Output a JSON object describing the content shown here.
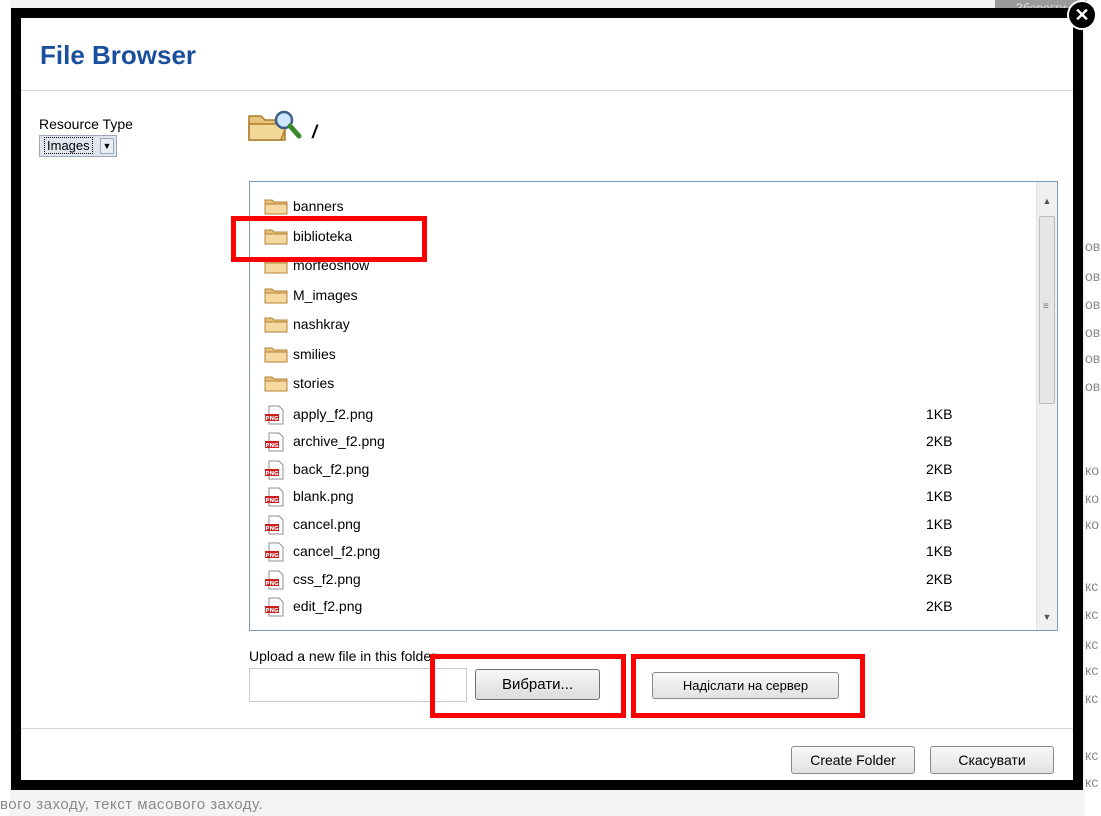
{
  "dialog": {
    "title": "File Browser",
    "resource_type_label": "Resource Type",
    "resource_type_value": "Images",
    "path": "/",
    "upload_label": "Upload a new file in this folder",
    "browse_button": "Вибрати...",
    "send_button": "Надіслати на сервер",
    "create_folder_button": "Create Folder",
    "cancel_button": "Скасувати",
    "close_icon": "close-icon",
    "path_icon": "folder-search-icon"
  },
  "folders": [
    {
      "name": "banners"
    },
    {
      "name": "biblioteka"
    },
    {
      "name": "morfeoshow"
    },
    {
      "name": "M_images"
    },
    {
      "name": "nashkray"
    },
    {
      "name": "smilies"
    },
    {
      "name": "stories"
    }
  ],
  "files": [
    {
      "name": "apply_f2.png",
      "size": "1KB"
    },
    {
      "name": "archive_f2.png",
      "size": "2KB"
    },
    {
      "name": "back_f2.png",
      "size": "2KB"
    },
    {
      "name": "blank.png",
      "size": "1KB"
    },
    {
      "name": "cancel.png",
      "size": "1KB"
    },
    {
      "name": "cancel_f2.png",
      "size": "1KB"
    },
    {
      "name": "css_f2.png",
      "size": "2KB"
    },
    {
      "name": "edit_f2.png",
      "size": "2KB"
    }
  ],
  "background": {
    "save_button": "Зберегти",
    "bottom_text": "вого заходу, текст масового заходу.",
    "right_fragments": [
      "ов",
      "ов",
      "ов",
      "ов",
      "ов",
      "ов",
      "ко",
      "ко",
      "ко",
      "кс",
      "кс",
      "кс",
      "кс",
      "кс",
      "кс",
      "кс"
    ]
  },
  "colors": {
    "title": "#1a4f9c",
    "highlight": "#ff0000",
    "list_border": "#7a9ab8"
  }
}
